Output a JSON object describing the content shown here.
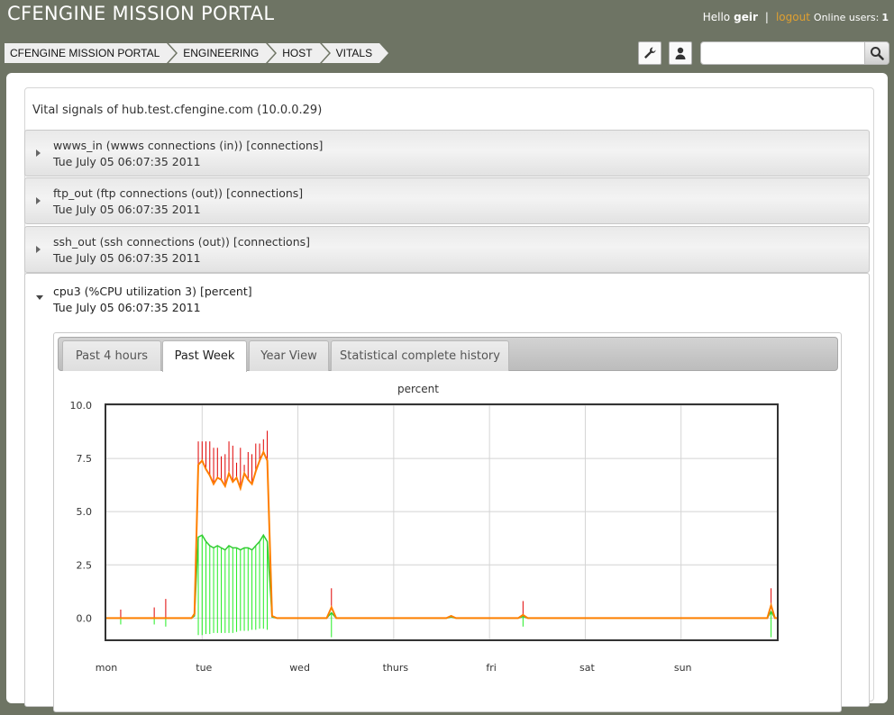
{
  "header": {
    "app_title": "CFENGINE MISSION PORTAL",
    "greeting": "Hello",
    "username": "geir",
    "separator": "|",
    "logout_label": "logout",
    "online_users_label": "Online users:",
    "online_users_count": "1"
  },
  "breadcrumb": [
    {
      "label": "CFENGINE MISSION PORTAL"
    },
    {
      "label": "ENGINEERING"
    },
    {
      "label": "HOST"
    },
    {
      "label": "VITALS"
    }
  ],
  "toolbar": {
    "settings_icon": "wrench-icon",
    "user_icon": "user-icon",
    "search_placeholder": "",
    "search_icon": "search-icon"
  },
  "page": {
    "heading": "Vital signals of hub.test.cfengine.com (10.0.0.29)"
  },
  "vitals": [
    {
      "name": "wwws_in (wwws connections (in)) [connections]",
      "timestamp": "Tue July 05 06:07:35 2011",
      "expanded": false
    },
    {
      "name": "ftp_out (ftp connections (out)) [connections]",
      "timestamp": "Tue July 05 06:07:35 2011",
      "expanded": false
    },
    {
      "name": "ssh_out (ssh connections (out)) [connections]",
      "timestamp": "Tue July 05 06:07:35 2011",
      "expanded": false
    },
    {
      "name": "cpu3 (%CPU utilization 3) [percent]",
      "timestamp": "Tue July 05 06:07:35 2011",
      "expanded": true
    }
  ],
  "tabs": [
    {
      "label": "Past 4 hours",
      "active": false
    },
    {
      "label": "Past Week",
      "active": true
    },
    {
      "label": "Year View",
      "active": false
    },
    {
      "label": "Statistical complete history",
      "active": false
    }
  ],
  "colors": {
    "header_bg": "#6e7464",
    "mean_line": "#ff7f00",
    "error_bar": "#e00000",
    "lower_line": "#33cc33",
    "lower_bar": "#22ee22"
  },
  "chart_data": {
    "type": "line",
    "title": "percent",
    "xlabel": "",
    "ylabel": "",
    "ylim": [
      -1,
      10
    ],
    "yticks": [
      "10.0",
      "7.5",
      "5.0",
      "2.5",
      "0.0"
    ],
    "ytick_values": [
      10,
      7.5,
      5,
      2.5,
      0
    ],
    "xlim": [
      0,
      7
    ],
    "xtick_labels": [
      "mon",
      "tue",
      "wed",
      "thurs",
      "fri",
      "sat",
      "sun"
    ],
    "grid": true,
    "legend": "none",
    "series": [
      {
        "key": "mean",
        "x": [
          0,
          0.15,
          0.5,
          0.62,
          0.89,
          0.92,
          0.96,
          1.0,
          1.04,
          1.08,
          1.12,
          1.16,
          1.2,
          1.24,
          1.28,
          1.32,
          1.36,
          1.4,
          1.44,
          1.48,
          1.52,
          1.56,
          1.6,
          1.64,
          1.68,
          1.73,
          1.78,
          2.3,
          2.35,
          2.4,
          3.55,
          3.6,
          3.65,
          4.3,
          4.35,
          4.4,
          6.9,
          6.94,
          6.98,
          7.0
        ],
        "values": [
          0,
          0,
          0,
          0,
          0,
          0.2,
          7.2,
          7.4,
          7.0,
          6.7,
          6.3,
          6.6,
          6.5,
          6.2,
          6.8,
          6.4,
          6.6,
          6.1,
          6.8,
          6.5,
          6.3,
          6.9,
          7.4,
          7.8,
          7.4,
          0.1,
          0,
          0,
          0.5,
          0,
          0,
          0.1,
          0,
          0,
          0.15,
          0,
          0,
          0.6,
          0,
          0
        ]
      },
      {
        "key": "lower",
        "x": [
          0,
          0.15,
          0.5,
          0.62,
          0.89,
          0.92,
          0.96,
          1.0,
          1.04,
          1.08,
          1.12,
          1.16,
          1.2,
          1.24,
          1.28,
          1.32,
          1.36,
          1.4,
          1.44,
          1.48,
          1.52,
          1.56,
          1.6,
          1.64,
          1.68,
          1.73,
          1.78,
          2.3,
          2.35,
          2.4,
          3.55,
          3.6,
          3.65,
          4.3,
          4.35,
          4.4,
          6.9,
          6.94,
          6.98,
          7.0
        ],
        "values": [
          0,
          0,
          0,
          0,
          0,
          0.1,
          3.8,
          3.9,
          3.6,
          3.4,
          3.3,
          3.4,
          3.3,
          3.2,
          3.4,
          3.3,
          3.3,
          3.2,
          3.3,
          3.3,
          3.2,
          3.4,
          3.6,
          3.9,
          3.6,
          0.05,
          0,
          0,
          0.25,
          0,
          0,
          0.05,
          0,
          0,
          0.07,
          0,
          0,
          0.3,
          0,
          0
        ]
      },
      {
        "key": "upper_spikes",
        "x": [
          0.15,
          0.5,
          0.62,
          0.96,
          1.0,
          1.04,
          1.08,
          1.12,
          1.16,
          1.2,
          1.24,
          1.28,
          1.32,
          1.36,
          1.4,
          1.44,
          1.48,
          1.52,
          1.56,
          1.6,
          1.64,
          1.68,
          2.35,
          4.35,
          6.94
        ],
        "values": [
          0.4,
          0.5,
          0.9,
          8.3,
          8.3,
          8.3,
          8.3,
          8.0,
          8.0,
          7.6,
          7.7,
          8.3,
          8.1,
          7.3,
          8.0,
          7.2,
          7.8,
          7.7,
          8.2,
          8.2,
          8.4,
          8.8,
          1.4,
          0.8,
          1.4
        ]
      },
      {
        "key": "lower_spikes",
        "x": [
          0.15,
          0.5,
          0.62,
          0.96,
          1.0,
          1.04,
          1.08,
          1.12,
          1.16,
          1.2,
          1.24,
          1.28,
          1.32,
          1.36,
          1.4,
          1.44,
          1.48,
          1.52,
          1.56,
          1.6,
          1.64,
          1.68,
          2.35,
          4.35,
          6.94
        ],
        "values": [
          -0.3,
          -0.3,
          -0.4,
          -0.8,
          -0.8,
          -0.75,
          -0.75,
          -0.7,
          -0.7,
          -0.7,
          -0.7,
          -0.7,
          -0.7,
          -0.65,
          -0.6,
          -0.6,
          -0.6,
          -0.55,
          -0.55,
          -0.5,
          -0.5,
          -0.55,
          -0.9,
          -0.4,
          -0.9
        ]
      }
    ]
  }
}
